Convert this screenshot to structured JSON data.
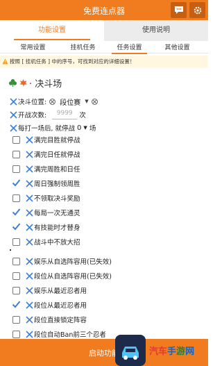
{
  "app": {
    "title": "免费连点器"
  },
  "main_tabs": [
    {
      "label": "功能设置",
      "active": true
    },
    {
      "label": "使用说明",
      "active": false
    }
  ],
  "sub_tabs": [
    {
      "label": "常用设置",
      "active": false
    },
    {
      "label": "挂机任务",
      "active": false
    },
    {
      "label": "任务设置",
      "active": true
    },
    {
      "label": "其他设置",
      "active": false
    }
  ],
  "notice": {
    "text": "按照 [ 挂机任务 ] 中的序号，可找到对应的详细设置！"
  },
  "section": {
    "title": "· 决斗场"
  },
  "duel": {
    "position_label": "决斗位置:",
    "position_value": "段位赛",
    "count_label": "开战次数:",
    "count_placeholder": "9999",
    "count_unit": "次",
    "rest_label": "每打一场后, 就停战",
    "rest_value": "0",
    "rest_unit": "场"
  },
  "options_a": [
    {
      "label": "满完目胜就停战",
      "checked": false
    },
    {
      "label": "满完日任就停战",
      "checked": false
    },
    {
      "label": "满完周胜和日任",
      "checked": false
    },
    {
      "label": "周日强制领周胜",
      "checked": true
    },
    {
      "label": "不领取决斗奖励",
      "checked": false
    },
    {
      "label": "每局一次无通灵",
      "checked": true
    },
    {
      "label": "有技能时才替身",
      "checked": true
    },
    {
      "label": "战斗中不放大招",
      "checked": false
    }
  ],
  "options_b": [
    {
      "label": "娱乐从自选阵容用(已失效)",
      "checked": false
    },
    {
      "label": "段位从自选阵容用(已失效)",
      "checked": false
    },
    {
      "label": "娱乐从最近忍者用",
      "checked": false
    },
    {
      "label": "段位从最近忍者用",
      "checked": true
    },
    {
      "label": "段位直接锁定阵容",
      "checked": false
    },
    {
      "label": "段位自动Ban前三个忍者",
      "checked": false
    }
  ],
  "footer": {
    "start_label": "启动功能",
    "watermark": [
      "汽",
      "车",
      "手",
      "游",
      "网"
    ]
  },
  "colors": {
    "accent": "#f07c1f",
    "check": "#3f7fd8",
    "notice_bg": "#fff7e0"
  }
}
